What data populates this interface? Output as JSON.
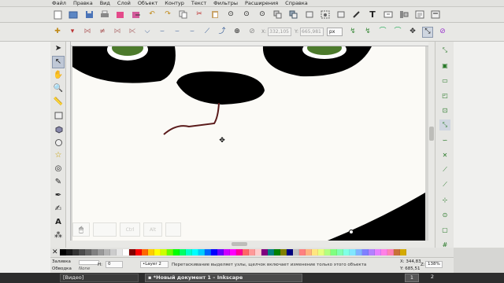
{
  "menu": [
    "Файл",
    "Правка",
    "Вид",
    "Слой",
    "Объект",
    "Контур",
    "Текст",
    "Фильтры",
    "Расширения",
    "Справка"
  ],
  "commands_icons": [
    "new-document-icon",
    "open-icon",
    "save-icon",
    "print-icon",
    "import-icon",
    "export-icon",
    "undo-icon",
    "redo-icon",
    "copy-icon",
    "cut-icon",
    "paste-icon",
    "zoom-selection-icon",
    "zoom-drawing-icon",
    "zoom-page-icon",
    "duplicate-icon",
    "clone-icon",
    "unlink-clone-icon",
    "group-icon",
    "ungroup-icon",
    "fill-stroke-icon",
    "text-tool-icon",
    "layers-icon",
    "align-icon",
    "xml-editor-icon",
    "preferences-icon"
  ],
  "node_controls": {
    "x_label": "X:",
    "x_value": "332,105",
    "y_label": "Y:",
    "y_value": "665,981",
    "unit": "px"
  },
  "page_ghost_buttons": [
    "Ctrl",
    "Alt"
  ],
  "palette": [
    "#000000",
    "#1a1a1a",
    "#333333",
    "#4d4d4d",
    "#666666",
    "#808080",
    "#999999",
    "#b3b3b3",
    "#cccccc",
    "#e6e6e6",
    "#ffffff",
    "#800000",
    "#ff0000",
    "#ff6600",
    "#ffcc00",
    "#ffff00",
    "#ccff00",
    "#66ff00",
    "#00ff00",
    "#00ff66",
    "#00ffcc",
    "#00ffff",
    "#00ccff",
    "#0066ff",
    "#0000ff",
    "#6600ff",
    "#cc00ff",
    "#ff00ff",
    "#ff0099",
    "#ff6666",
    "#ff9999",
    "#ffcccc",
    "#800080",
    "#008080",
    "#008000",
    "#808000",
    "#000080",
    "#c0c0c0",
    "#ff8080",
    "#ffb380",
    "#ffe680",
    "#e6ff80",
    "#b3ff80",
    "#80ff80",
    "#80ffb3",
    "#80ffe6",
    "#80e6ff",
    "#80b3ff",
    "#8080ff",
    "#b380ff",
    "#e680ff",
    "#ff80e6",
    "#ff80b3",
    "#c87137",
    "#d4aa00"
  ],
  "status": {
    "fill_label": "Заливка",
    "stroke_label": "Обводка",
    "stroke_value": "None",
    "opacity_label": "Н:",
    "opacity_value": "0",
    "layer": "•Layer 2",
    "message": "Перетаскивание выделяет узлы, щелчок включает изменение только этого объекта",
    "x_coord": "X: 344,83",
    "y_coord": "Y: 685,51",
    "zoom_label": "Z:",
    "zoom": "138%"
  },
  "taskbar": {
    "left": "[Видео]",
    "active": "*Новый документ 1 – Inkscape",
    "ws1": "1",
    "ws2": "2"
  }
}
